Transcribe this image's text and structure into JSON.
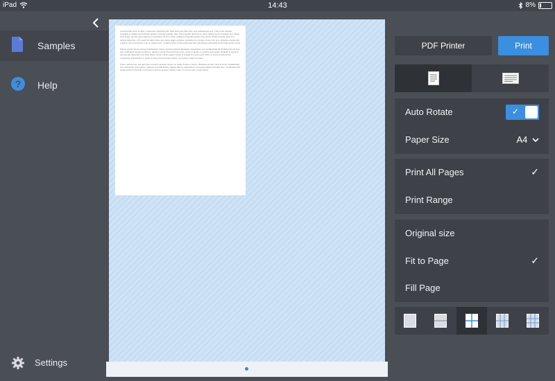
{
  "status": {
    "device": "iPad",
    "time": "14:43",
    "battery": "8%"
  },
  "sidebar": {
    "items": [
      {
        "label": "Samples",
        "icon": "document-icon"
      },
      {
        "label": "Help",
        "icon": "help-icon"
      }
    ],
    "settings_label": "Settings"
  },
  "preview": {
    "paragraphs": [
      "Lorem ipsum dolor sit amet, consectetur adipiscing elit. Maecenas quis diam odio, eget pellentesque arcu. Cum sociis natoque penatibus et magnis dis parturient montes, nascetur ridiculus mus. Fusce feugiat rhoncus est, vitae tristique lacus accumsan non. Morbi risus neque, gravida eget tempus id, fermentum vel arcu. Nunc commodo imperdiet ipsum vitae ornare. Mauris rutrum, nunc non tempus imperdiet, velit quam tincidunt tellus, non varius augue ut metus. Aliquam erat volutpat. Proin a leo arcu. Aliquam posuere nisi volutpat velit porta mattis. Cras ac sapien dolor, a sagittis tellus. Proin scelerisque felis quis massa sollicitudin ut tincidunt lorem cursus.",
      "Mauris sodales aliquet purus id fermentum. Donec gravida pulvinar dignissim. Suspendisse sed condimentum mi. Nullam placerat ante nisi, vestibulum feugiat pretium ac, mollis at lorem. Praesent libero arcu, ornare et mollis et, porttitor quis neque. Aliquam ut metus in nisi suscipit imperdiet at sit amet massa. Donec cursus sagittis lorem, at feugiat arcu porta quis. Nunc ac lectus ut urna luctus consectetur. Pellentesque at quam sit amet purus molestie mollis. Sed porttitor enim vel turpis.",
      "Proin a nibh lectus. Sed quis urna at ipsum venenatis luctus a ut augue. Etiam ac mi leo. Phasellus porttitor risus id lacus condimentum non sollicitudin risus egestas. Quisque non nibh mauris. Mauris ultrices dignissim est, id laoreet magna tincidunt vitae. Vestibulum ante ipsum primis in faucibus orci luctus et ultrices posuere cubilia Curae; Ut viverra odio at odio mattis."
    ]
  },
  "actions": {
    "pdf_label": "PDF Printer",
    "print_label": "Print"
  },
  "options": {
    "auto_rotate_label": "Auto Rotate",
    "auto_rotate_on": true,
    "paper_size_label": "Paper Size",
    "paper_size_value": "A4",
    "print_all_label": "Print All Pages",
    "print_range_label": "Print Range",
    "original_size_label": "Original size",
    "fit_to_page_label": "Fit to Page",
    "fill_page_label": "Fill Page"
  },
  "colors": {
    "accent": "#3b8fe0",
    "panel": "#3e4248",
    "sidebar": "#4a4e55"
  }
}
